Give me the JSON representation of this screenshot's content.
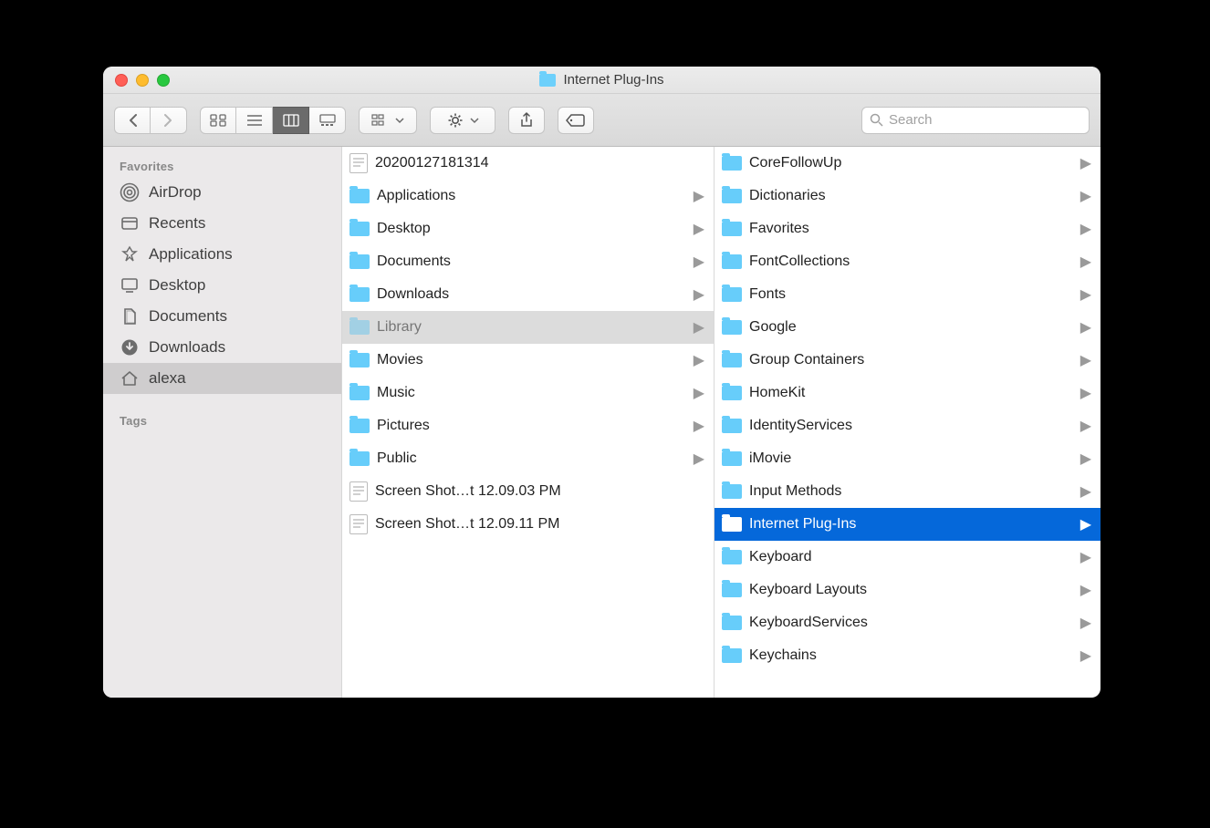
{
  "window": {
    "title": "Internet Plug-Ins"
  },
  "toolbar": {
    "search_placeholder": "Search"
  },
  "sidebar": {
    "favorites_label": "Favorites",
    "tags_label": "Tags",
    "items": [
      {
        "icon": "airdrop",
        "label": "AirDrop"
      },
      {
        "icon": "recents",
        "label": "Recents"
      },
      {
        "icon": "apps",
        "label": "Applications"
      },
      {
        "icon": "desktop",
        "label": "Desktop"
      },
      {
        "icon": "documents",
        "label": "Documents"
      },
      {
        "icon": "downloads",
        "label": "Downloads"
      },
      {
        "icon": "home",
        "label": "alexa",
        "selected": true
      }
    ]
  },
  "columns": [
    {
      "items": [
        {
          "type": "file",
          "label": "20200127181314",
          "arrow": false
        },
        {
          "type": "folder",
          "label": "Applications",
          "arrow": true
        },
        {
          "type": "folder",
          "label": "Desktop",
          "arrow": true
        },
        {
          "type": "folder",
          "label": "Documents",
          "arrow": true
        },
        {
          "type": "folder",
          "label": "Downloads",
          "arrow": true
        },
        {
          "type": "folder",
          "label": "Library",
          "arrow": true,
          "parent": true
        },
        {
          "type": "folder",
          "label": "Movies",
          "arrow": true
        },
        {
          "type": "folder",
          "label": "Music",
          "arrow": true
        },
        {
          "type": "folder",
          "label": "Pictures",
          "arrow": true
        },
        {
          "type": "folder",
          "label": "Public",
          "arrow": true
        },
        {
          "type": "file",
          "label": "Screen Shot…t 12.09.03 PM",
          "arrow": false
        },
        {
          "type": "file",
          "label": "Screen Shot…t 12.09.11 PM",
          "arrow": false
        }
      ]
    },
    {
      "items": [
        {
          "type": "folder",
          "label": "CoreFollowUp",
          "arrow": true
        },
        {
          "type": "folder",
          "label": "Dictionaries",
          "arrow": true
        },
        {
          "type": "folder",
          "label": "Favorites",
          "arrow": true
        },
        {
          "type": "folder",
          "label": "FontCollections",
          "arrow": true
        },
        {
          "type": "folder",
          "label": "Fonts",
          "arrow": true
        },
        {
          "type": "folder",
          "label": "Google",
          "arrow": true
        },
        {
          "type": "folder",
          "label": "Group Containers",
          "arrow": true
        },
        {
          "type": "folder",
          "label": "HomeKit",
          "arrow": true
        },
        {
          "type": "folder",
          "label": "IdentityServices",
          "arrow": true
        },
        {
          "type": "folder",
          "label": "iMovie",
          "arrow": true
        },
        {
          "type": "folder",
          "label": "Input Methods",
          "arrow": true
        },
        {
          "type": "folder",
          "label": "Internet Plug-Ins",
          "arrow": true,
          "selected": true
        },
        {
          "type": "folder",
          "label": "Keyboard",
          "arrow": true
        },
        {
          "type": "folder",
          "label": "Keyboard Layouts",
          "arrow": true
        },
        {
          "type": "folder",
          "label": "KeyboardServices",
          "arrow": true
        },
        {
          "type": "folder",
          "label": "Keychains",
          "arrow": true
        }
      ]
    }
  ]
}
